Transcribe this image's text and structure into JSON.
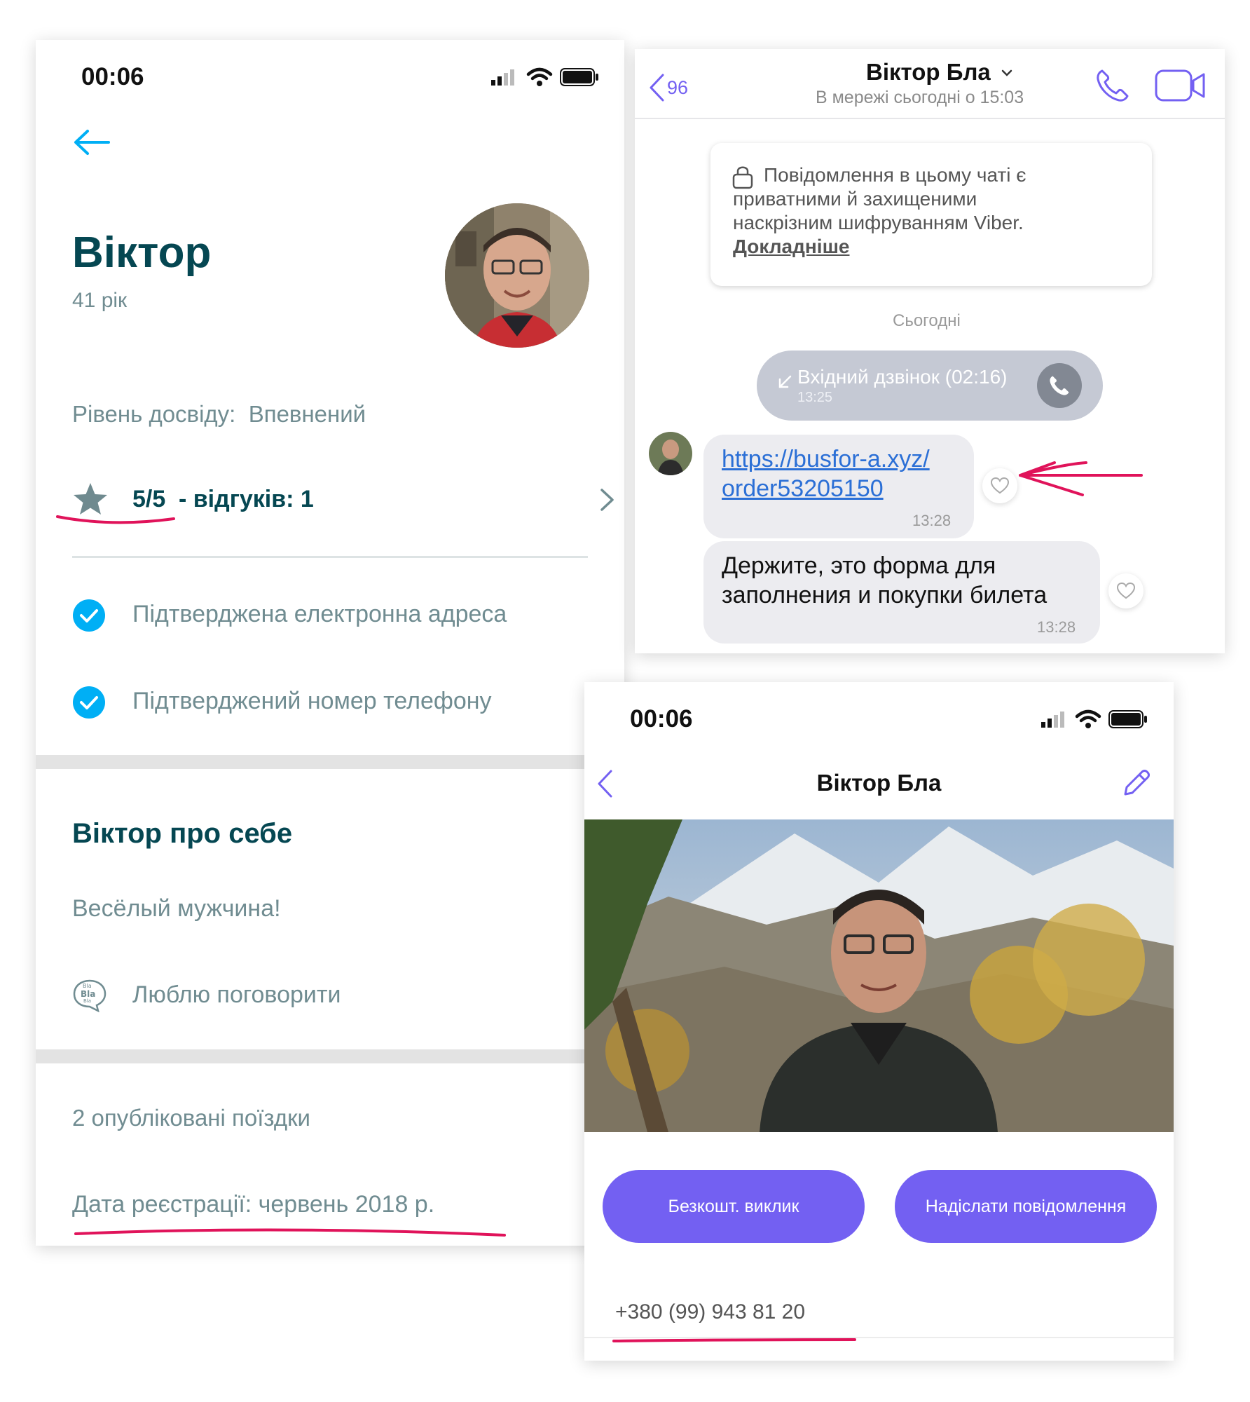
{
  "profile": {
    "status_time": "00:06",
    "name": "Віктор",
    "age": "41 рік",
    "experience_label": "Рівень досвіду:",
    "experience_value": "Впевнений",
    "rating": "5/5",
    "reviews": "- відгуків: 1",
    "verified_email": "Підтверджена електронна адреса",
    "verified_phone": "Підтверджений номер телефону",
    "about_title": "Віктор про себе",
    "about_text": "Весёлый мужчина!",
    "talk_pref": "Люблю поговорити",
    "bla_icon_text": [
      "Bla",
      "Bla",
      "Bla"
    ],
    "published_trips": "2 опубліковані поїздки",
    "registration": "Дата реєстрації: червень 2018 р."
  },
  "chat": {
    "back_count": "96",
    "contact_name": "Віктор Бла",
    "last_seen": "В мережі сьогодні о 15:03",
    "encryption_notice": [
      "Повідомлення в цьому чаті є",
      "приватними й захищеними",
      "наскрізним шифруванням Viber."
    ],
    "learn_more": "Докладніше",
    "date_separator": "Сьогодні",
    "call_text": "Вхідний дзвінок (02:16)",
    "call_time": "13:25",
    "link_line1": "https://busfor-a.xyz/",
    "link_line2": "order53205150",
    "link_time": "13:28",
    "message_line1": "Держите, это форма для",
    "message_line2": "заполнения и покупки билета",
    "message_time": "13:28"
  },
  "contact": {
    "status_time": "00:06",
    "title": "Віктор Бла",
    "free_call": "Безкошт. виклик",
    "send_message": "Надіслати повідомлення",
    "phone": "+380 (99) 943 81 20"
  },
  "colors": {
    "bb_teal_dark": "#054752",
    "bb_text": "#708c91",
    "bb_blue": "#00aff5",
    "viber_purple": "#7360f2",
    "link_blue": "#2b6fd6",
    "annotation_red": "#e0135a"
  }
}
